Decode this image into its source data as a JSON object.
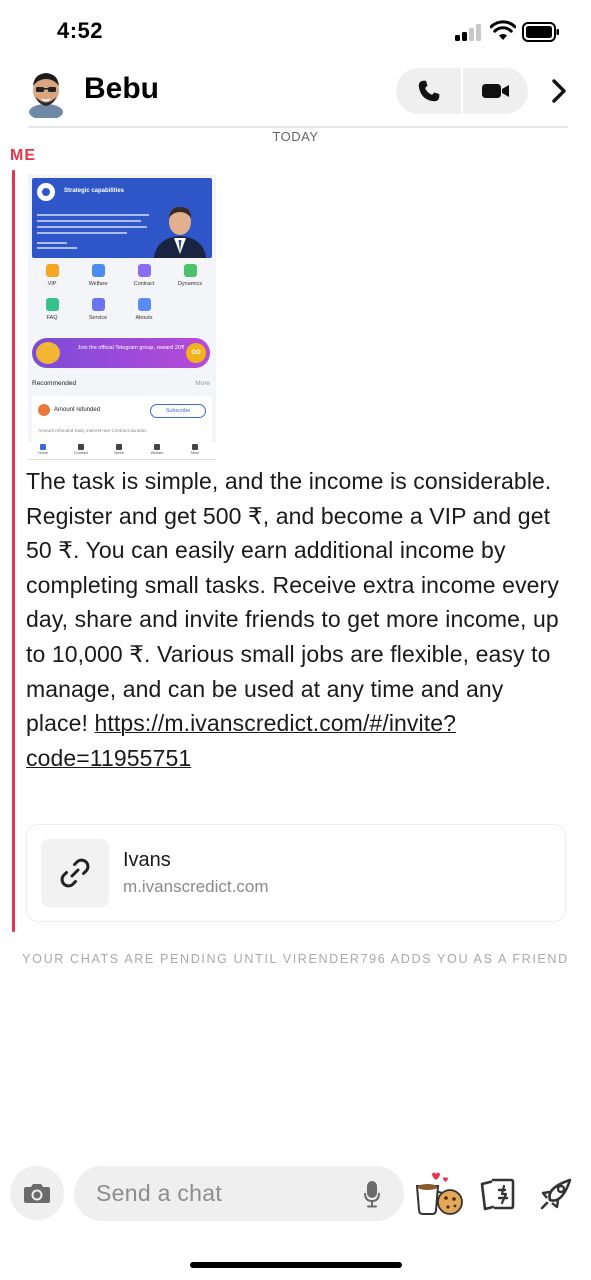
{
  "status_bar": {
    "time": "4:52"
  },
  "header": {
    "contact_name": "Bebu",
    "call_icon": "phone-icon",
    "video_icon": "video-camera-icon",
    "more_icon": "chevron-right-icon"
  },
  "conversation": {
    "date_label": "TODAY",
    "sender": "ME",
    "accent_color": "#e8344e",
    "attachment": {
      "banner_title": "Strategic capabilities",
      "apps": [
        "VIP",
        "Welfare",
        "Contract",
        "Dynamics",
        "FAQ",
        "Service",
        "Abouts"
      ],
      "promo_text": "Join the official Telegram group, reward 20₹",
      "promo_button": "GO",
      "recommended_label": "Recommended",
      "more_label": "More",
      "card_title": "Amount refunded",
      "subscribe_label": "Subscribe",
      "card_columns": "Amount refunded   Daily interest rate   Contract duration",
      "tabs": [
        "Home",
        "Contract",
        "News",
        "Welfare",
        "Mine"
      ]
    },
    "message_text": "The task is simple, and the income is considerable. Register and get 500 ₹, and become a VIP and get 50 ₹. You can easily earn additional income by completing small tasks. Receive extra income every day, share and invite friends to get more income, up to 10,000 ₹. Various small jobs are flexible, easy to manage, and can be used at any time and any place!",
    "message_link": "https://m.ivanscredict.com/#/invite?code=11955751",
    "link_preview": {
      "title": "Ivans",
      "domain": "m.ivanscredict.com",
      "icon": "link-icon"
    },
    "pending_notice": "YOUR CHATS ARE PENDING UNTIL VIRENDER796 ADDS YOU AS A FRIEND"
  },
  "composer": {
    "placeholder": "Send a chat",
    "camera_icon": "camera-icon",
    "mic_icon": "microphone-icon",
    "sticker_icon": "sticker-icon",
    "cards_icon": "cards-icon",
    "rocket_icon": "rocket-icon"
  }
}
